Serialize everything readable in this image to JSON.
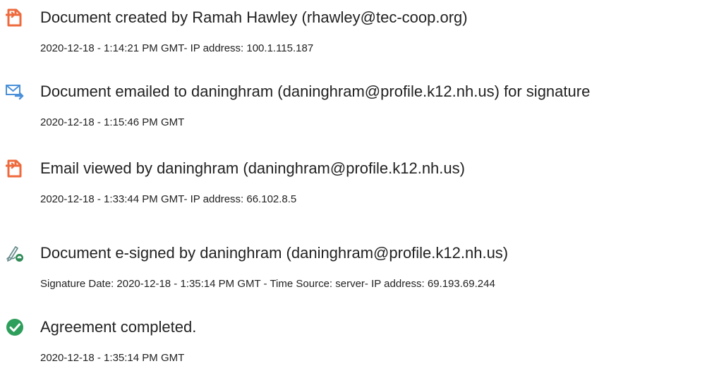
{
  "colors": {
    "document_icon": "#ee6a3c",
    "email_icon": "#4a90d9",
    "signature_icon": "#2e8b57",
    "completed_icon": "#2e9e5b",
    "text": "#222222"
  },
  "events": [
    {
      "icon": "document-icon",
      "title": "Document created by Ramah Hawley (rhawley@tec-coop.org)",
      "detail": "2020-12-18 - 1:14:21 PM GMT- IP address: 100.1.115.187"
    },
    {
      "icon": "email-forward-icon",
      "title": "Document emailed to daninghram (daninghram@profile.k12.nh.us) for signature",
      "detail": "2020-12-18 - 1:15:46 PM GMT"
    },
    {
      "icon": "document-icon",
      "title": "Email viewed by daninghram (daninghram@profile.k12.nh.us)",
      "detail": "2020-12-18 - 1:33:44 PM GMT- IP address: 66.102.8.5"
    },
    {
      "icon": "pen-signature-icon",
      "title": "Document e-signed by daninghram (daninghram@profile.k12.nh.us)",
      "detail": "Signature Date: 2020-12-18 - 1:35:14 PM GMT - Time Source: server- IP address: 69.193.69.244"
    },
    {
      "icon": "check-circle-icon",
      "title": "Agreement completed.",
      "detail": "2020-12-18 - 1:35:14 PM GMT"
    }
  ]
}
